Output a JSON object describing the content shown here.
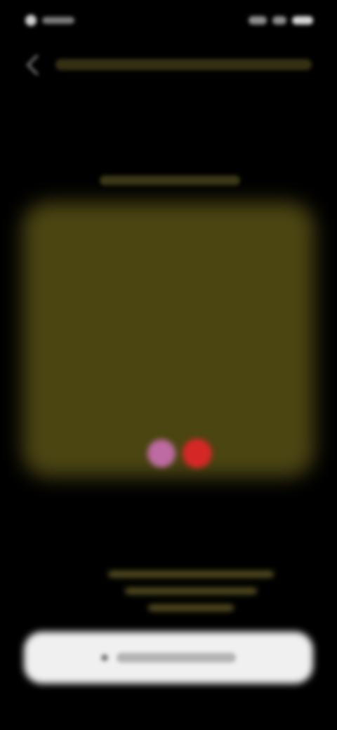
{
  "status_bar": {
    "left": "",
    "right": ""
  },
  "header": {
    "title": ""
  },
  "section": {
    "label": ""
  },
  "card": {
    "title": "",
    "line_1": "",
    "line_2": "",
    "line_3": "",
    "metric_1": "",
    "metric_2": "",
    "metric_3": ""
  },
  "cta": {
    "label": ""
  },
  "icons": {
    "back": "back-icon",
    "logo_a": "logo-icon",
    "logo_b": "logo-icon",
    "cta": "play-icon"
  },
  "colors": {
    "background": "#000000",
    "card": "#4b4512",
    "cta": "#f0f0f0",
    "logo_a": "#bd6ba0",
    "logo_b": "#d62727"
  }
}
